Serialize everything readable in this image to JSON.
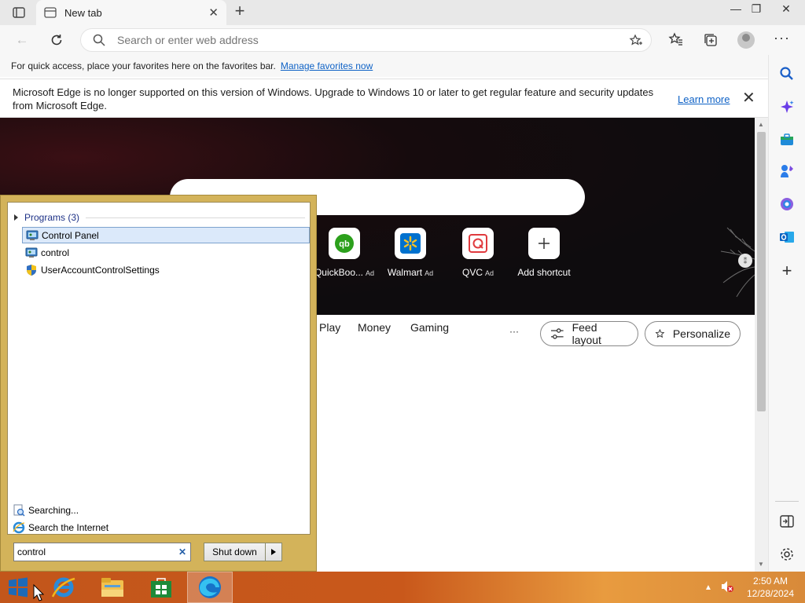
{
  "browser": {
    "tab_title": "New tab",
    "window_controls": {
      "minimize": "—",
      "restore": "❐",
      "close": "✕"
    },
    "address_placeholder": "Search or enter web address",
    "favorites_bar": {
      "text": "For quick access, place your favorites here on the favorites bar.",
      "link": "Manage favorites now"
    },
    "notice": {
      "message": "Microsoft Edge is no longer supported on this version of Windows. Upgrade to Windows 10 or later to get regular feature and security updates from Microsoft Edge.",
      "link": "Learn more"
    },
    "sidebar_icons": [
      "search-icon",
      "copilot-icon",
      "shopping-icon",
      "games-icon",
      "office-icon",
      "outlook-icon",
      "add-icon",
      "split-screen-icon",
      "settings-icon"
    ]
  },
  "newtab": {
    "shortcuts": [
      {
        "label": "QuickBoo...",
        "ad": "Ad",
        "color": "#2ca01c"
      },
      {
        "label": "Walmart",
        "ad": "Ad",
        "color": "#0071ce"
      },
      {
        "label": "QVC",
        "ad": "Ad",
        "color": "#e03a3e"
      },
      {
        "label": "Add shortcut",
        "ad": ""
      }
    ],
    "feed_tabs": [
      "Play",
      "Money",
      "Gaming"
    ],
    "more_label": "···",
    "feed_layout_label": "Feed layout",
    "personalize_label": "Personalize"
  },
  "start_menu": {
    "group_label": "Programs (3)",
    "items": [
      "Control Panel",
      "control",
      "UserAccountControlSettings"
    ],
    "searching_label": "Searching...",
    "search_internet_label": "Search the Internet",
    "search_value": "control",
    "shutdown_label": "Shut down"
  },
  "taskbar": {
    "apps": [
      "internet-explorer-icon",
      "file-explorer-icon",
      "store-icon",
      "edge-icon"
    ],
    "time": "2:50 AM",
    "date": "12/28/2024"
  },
  "colors": {
    "accent": "#0f62c6",
    "taskbar": "#c9581b",
    "start_menu_frame": "#d3b35a"
  }
}
